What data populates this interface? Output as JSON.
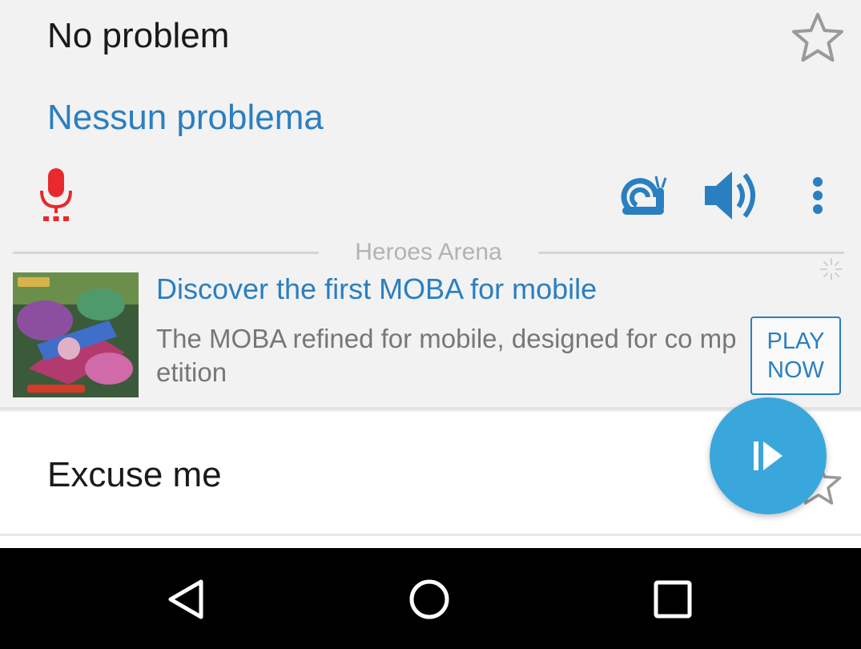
{
  "phrase_card": {
    "source": "No problem",
    "translation": "Nessun problema"
  },
  "icons": {
    "favorite": "star-outline-icon",
    "microphone": "microphone-icon",
    "slow_playback": "snail-icon",
    "speaker": "speaker-icon",
    "more": "more-vertical-icon"
  },
  "ad": {
    "brand": "Heroes Arena",
    "title": "Discover the first MOBA for mobile",
    "description": "The MOBA refined for mobile, designed for co mpetition",
    "cta_line1": "PLAY",
    "cta_line2": "NOW"
  },
  "phrase_list": [
    {
      "text": "Excuse me"
    }
  ],
  "colors": {
    "accent_blue": "#2a7fc1",
    "fab_blue": "#3aa7dc",
    "mic_red": "#e8292d"
  }
}
